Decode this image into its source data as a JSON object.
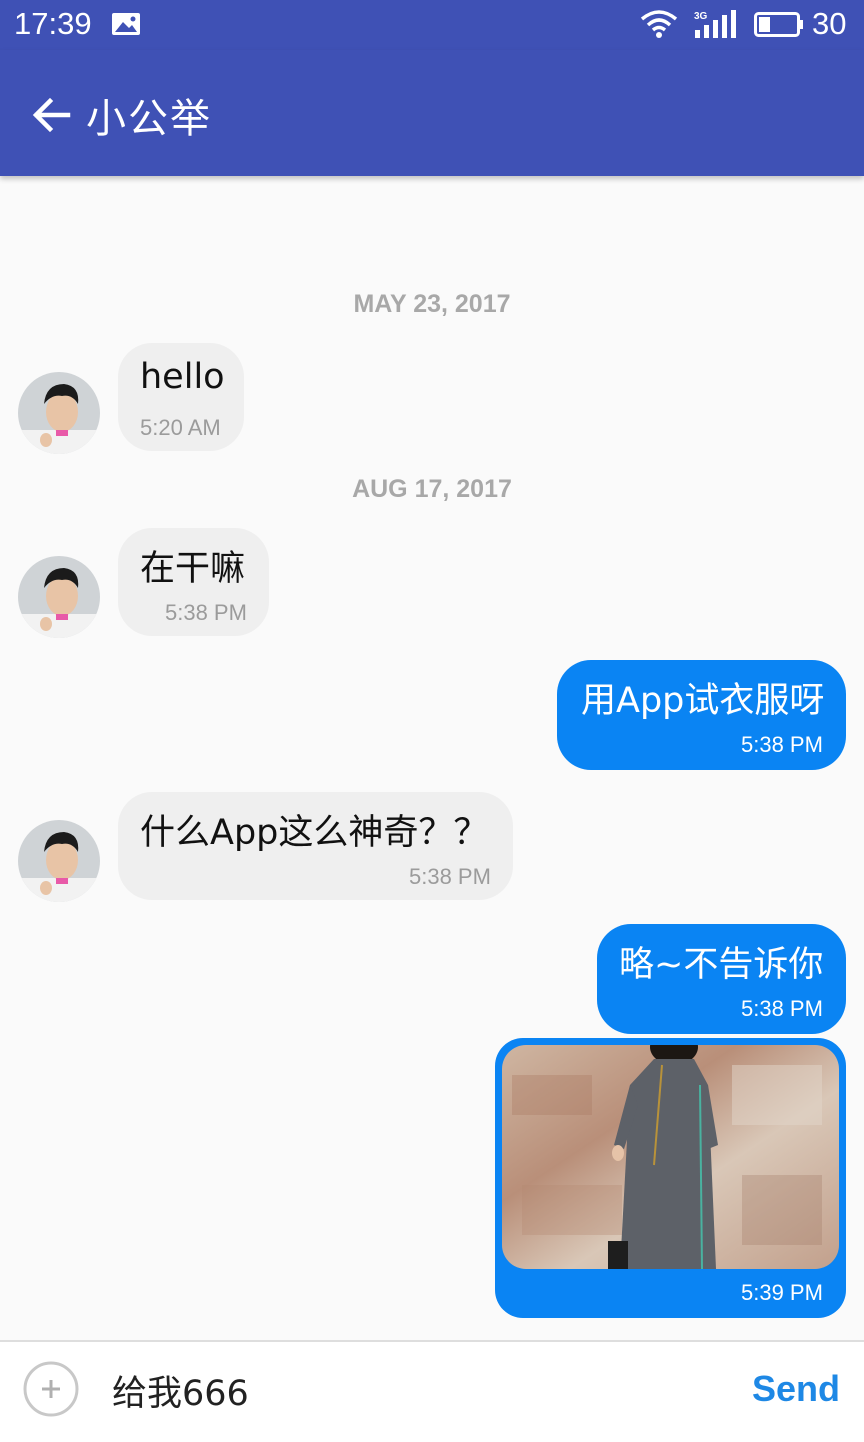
{
  "status_bar": {
    "time": "17:39",
    "network_label": "3G",
    "battery_level": "30",
    "icons": [
      "image-notification-icon",
      "wifi-icon",
      "cellular-signal-icon",
      "battery-icon"
    ]
  },
  "toolbar": {
    "title": "小公举",
    "background": "#3f51b5",
    "back_icon": "arrow-back-icon"
  },
  "messages": [
    {
      "date": "MAY 23, 2017"
    },
    {
      "direction": "incoming",
      "text": "hello",
      "time": "5:20 AM"
    },
    {
      "date": "AUG 17, 2017"
    },
    {
      "direction": "incoming",
      "text": "在干嘛",
      "time": "5:38 PM"
    },
    {
      "direction": "outgoing",
      "text": "用App试衣服呀",
      "time": "5:38 PM"
    },
    {
      "direction": "incoming",
      "text": "什么App这么神奇？？",
      "time": "5:38 PM"
    },
    {
      "direction": "outgoing",
      "text": "略~不告诉你",
      "time": "5:38 PM"
    },
    {
      "direction": "outgoing",
      "type": "image",
      "image": "woman-in-grey-dress-photo",
      "time": "5:39 PM"
    }
  ],
  "composer": {
    "input_value": "给我666",
    "send_label": "Send",
    "attach_icon": "plus-circle-icon"
  },
  "colors": {
    "outgoing_bubble": "#0a84f3",
    "incoming_bubble": "#efefef",
    "date_text": "#a8a8a8",
    "send_text": "#1e88e5"
  }
}
